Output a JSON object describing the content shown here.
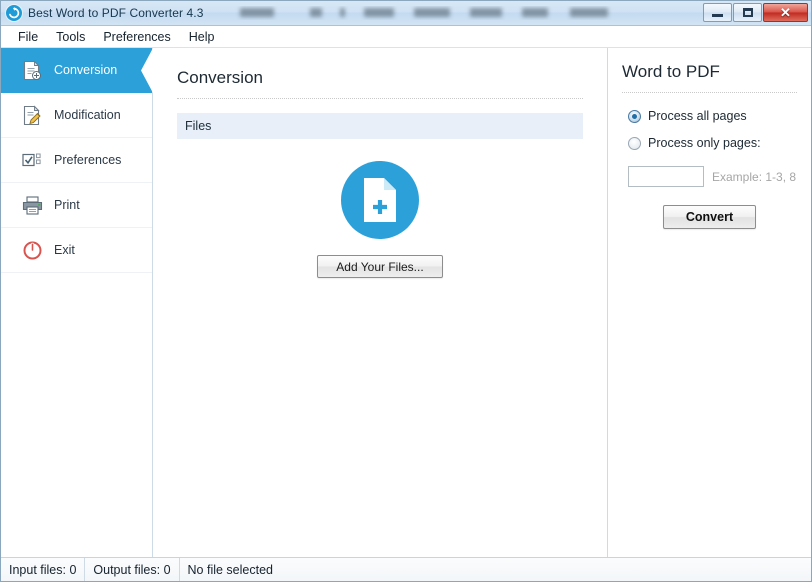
{
  "window": {
    "title": "Best Word to PDF Converter 4.3",
    "app_icon": "convert-circle-icon",
    "titlebar_redacted": true,
    "controls": {
      "minimize_label": "minimize-icon",
      "maximize_label": "maximize-icon",
      "close_label": "✕"
    }
  },
  "menubar": {
    "items": [
      {
        "label": "File"
      },
      {
        "label": "Tools"
      },
      {
        "label": "Preferences"
      },
      {
        "label": "Help"
      }
    ]
  },
  "sidebar": {
    "items": [
      {
        "label": "Conversion",
        "icon": "document-convert-icon",
        "active": true
      },
      {
        "label": "Modification",
        "icon": "document-edit-icon",
        "active": false
      },
      {
        "label": "Preferences",
        "icon": "checklist-icon",
        "active": false
      },
      {
        "label": "Print",
        "icon": "printer-icon",
        "active": false
      },
      {
        "label": "Exit",
        "icon": "power-icon",
        "active": false
      }
    ]
  },
  "main": {
    "title": "Conversion",
    "files_header": "Files",
    "drop_icon": "add-file-icon",
    "add_files_button": "Add Your Files..."
  },
  "right_panel": {
    "title": "Word to PDF",
    "options": [
      {
        "label": "Process all pages",
        "selected": true
      },
      {
        "label": "Process only pages:",
        "selected": false
      }
    ],
    "pages_input_value": "",
    "pages_input_placeholder": "",
    "pages_hint": "Example: 1-3, 8",
    "convert_button": "Convert"
  },
  "statusbar": {
    "input_files": "Input files: 0",
    "output_files": "Output files: 0",
    "selection": "No file selected"
  },
  "colors": {
    "accent": "#2ba0d9",
    "titlebar": "#cfe2f3",
    "close_button": "#d9544a",
    "files_header": "#e8eff8",
    "exit_icon": "#d9534f"
  }
}
